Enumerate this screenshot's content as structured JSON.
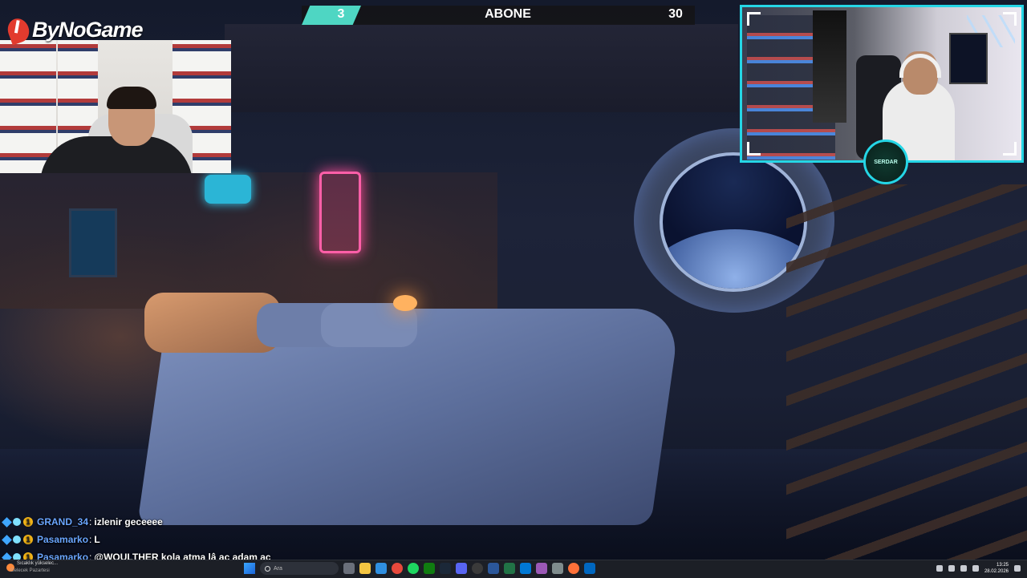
{
  "stream": {
    "brand": "ByNoGame",
    "counter": {
      "left_value": "3",
      "label": "ABONE",
      "right_value": "30"
    },
    "seal_text": "SERDAR"
  },
  "chat": [
    {
      "user": "GRAND_34",
      "message": "izlenir geceeee",
      "badge_number": "1"
    },
    {
      "user": "Pasamarko",
      "message": "L",
      "badge_number": "1"
    },
    {
      "user": "Pasamarko",
      "message": "@WOULTHER kola atma lâ aç adam aç",
      "badge_number": "1"
    }
  ],
  "taskbar": {
    "weather_line1": "Sıcaklık yükselec...",
    "weather_line2": "Gelecek Pazartesi",
    "search_placeholder": "Ara",
    "time": "13:25",
    "date": "28.02.2026",
    "apps": [
      "file-explorer",
      "edge",
      "chrome",
      "spotify",
      "xbox",
      "steam",
      "discord",
      "obs",
      "word",
      "excel",
      "photos",
      "mail",
      "settings",
      "firefox",
      "store"
    ],
    "colors": {
      "accent": "#25d6e6",
      "chat_user": "#6aa6ff",
      "counter_accent": "#4ed6c3"
    }
  }
}
